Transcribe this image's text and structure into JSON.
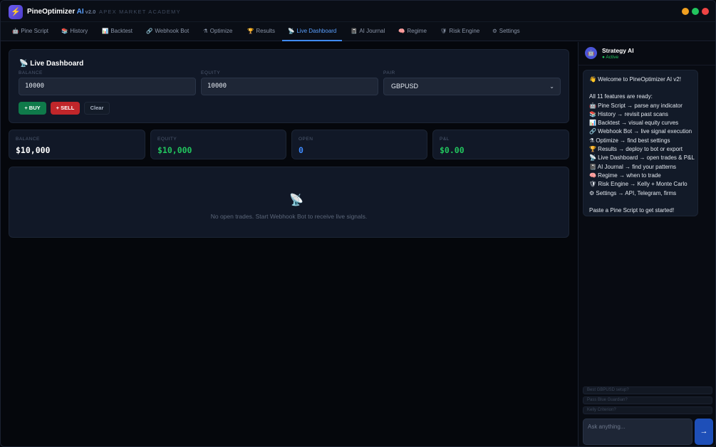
{
  "app": {
    "logo_glyph": "⚡",
    "name": "PineOptimizer",
    "name_ai": "AI",
    "version": "v2.0",
    "subtitle": "APEX MARKET ACADEMY"
  },
  "window_controls": {
    "minimize_color": "#f0a020",
    "maximize_color": "#22c55e",
    "close_color": "#ef4444"
  },
  "tabs": [
    {
      "icon": "🤖",
      "label": "Pine Script"
    },
    {
      "icon": "📚",
      "label": "History"
    },
    {
      "icon": "📊",
      "label": "Backtest"
    },
    {
      "icon": "🔗",
      "label": "Webhook Bot"
    },
    {
      "icon": "⚗",
      "label": "Optimize"
    },
    {
      "icon": "🏆",
      "label": "Results"
    },
    {
      "icon": "📡",
      "label": "Live Dashboard"
    },
    {
      "icon": "📓",
      "label": "AI Journal"
    },
    {
      "icon": "🧠",
      "label": "Regime"
    },
    {
      "icon": "🛡",
      "label": "Risk Engine"
    },
    {
      "icon": "⚙",
      "label": "Settings"
    }
  ],
  "active_tab": "Live Dashboard",
  "accent_color": "#3f8bff",
  "panel": {
    "icon": "📡",
    "title": "Live Dashboard",
    "balance_label": "BALANCE",
    "balance_value": "10000",
    "equity_label": "EQUITY",
    "equity_value": "10000",
    "pair_label": "PAIR",
    "pair_value": "GBPUSD",
    "buy_label": "+ BUY",
    "sell_label": "+ SELL",
    "clear_label": "Clear"
  },
  "stats": [
    {
      "label": "BALANCE",
      "value": "$10,000",
      "color": "#ffffff"
    },
    {
      "label": "EQUITY",
      "value": "$10,000",
      "color": "#22c55e"
    },
    {
      "label": "OPEN",
      "value": "0",
      "color": "#3f8bff"
    },
    {
      "label": "P&L",
      "value": "$0.00",
      "color": "#22c55e"
    }
  ],
  "trades": {
    "empty_icon": "📡",
    "empty_text": "No open trades. Start Webhook Bot to receive live signals."
  },
  "assistant": {
    "avatar": "🤖",
    "name": "Strategy AI",
    "status": "● Active",
    "welcome": "👋 Welcome to PineOptimizer AI v2!",
    "features_heading": "All 11 features are ready:",
    "features": [
      "🤖 Pine Script → parse any indicator",
      "📚 History → revisit past scans",
      "📊 Backtest → visual equity curves",
      "🔗 Webhook Bot → live signal execution",
      "⚗ Optimize → find best settings",
      "🏆 Results → deploy to bot or export",
      "📡 Live Dashboard → open trades & P&L",
      "📓 AI Journal → find your patterns",
      "🧠 Regime → when to trade",
      "🛡 Risk Engine → Kelly + Monte Carlo",
      "⚙ Settings → API, Telegram, firms"
    ],
    "closing": "Paste a Pine Script to get started!",
    "suggestions": [
      "Best GBPUSD setup?",
      "Pass Blue Guardian?",
      "Kelly Criterion?"
    ],
    "input_placeholder": "Ask anything...",
    "send_glyph": "→"
  }
}
